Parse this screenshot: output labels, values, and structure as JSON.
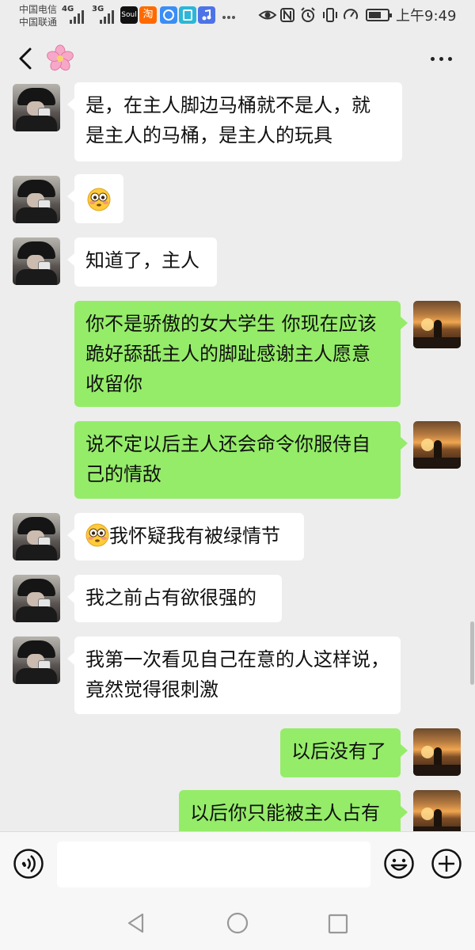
{
  "status_bar": {
    "carrier_1": "中国电信",
    "carrier_2": "中国联通",
    "signal_1": "4G",
    "signal_2": "3G",
    "soul_app": "Soul",
    "taobao_app": "淘",
    "time": "上午9:49",
    "battery_level": 0.7
  },
  "header": {
    "contact_icon": "cherry-blossom-icon",
    "back_icon": "chevron-left-icon",
    "more_icon": "more-dots-icon"
  },
  "messages": [
    {
      "side": "in",
      "lines": [
        "是，在主人脚边马桶就不是人，就",
        "是主人的马桶，是主人的玩具"
      ]
    },
    {
      "side": "in",
      "emoji": "flushed-face-emoji"
    },
    {
      "side": "in",
      "lines": [
        "知道了，主人"
      ]
    },
    {
      "side": "out",
      "lines": [
        "你不是骄傲的女大学生 你现在应该",
        "跪好舔舐主人的脚趾感谢主人愿意",
        "收留你"
      ]
    },
    {
      "side": "out",
      "lines": [
        "说不定以后主人还会命令你服侍自",
        "己的情敌"
      ]
    },
    {
      "side": "in",
      "emoji": "flushed-face-emoji",
      "lines": [
        "我怀疑我有被绿情节"
      ]
    },
    {
      "side": "in",
      "lines": [
        "我之前占有欲很强的"
      ]
    },
    {
      "side": "in",
      "lines": [
        "我第一次看见自己在意的人这样说，",
        "竟然觉得很刺激"
      ]
    },
    {
      "side": "out",
      "lines": [
        "以后没有了"
      ]
    },
    {
      "side": "out",
      "lines": [
        "以后你只能被主人占有"
      ]
    }
  ],
  "input_bar": {
    "voice_icon": "voice-icon",
    "input_value": "",
    "emoji_icon": "smiley-icon",
    "plus_icon": "plus-icon"
  },
  "system_nav": {
    "back_icon": "triangle-back-icon",
    "home_icon": "circle-home-icon",
    "recent_icon": "square-recent-icon"
  },
  "colors": {
    "background": "#ededed",
    "incoming_bubble": "#ffffff",
    "outgoing_bubble": "#95ec69"
  }
}
